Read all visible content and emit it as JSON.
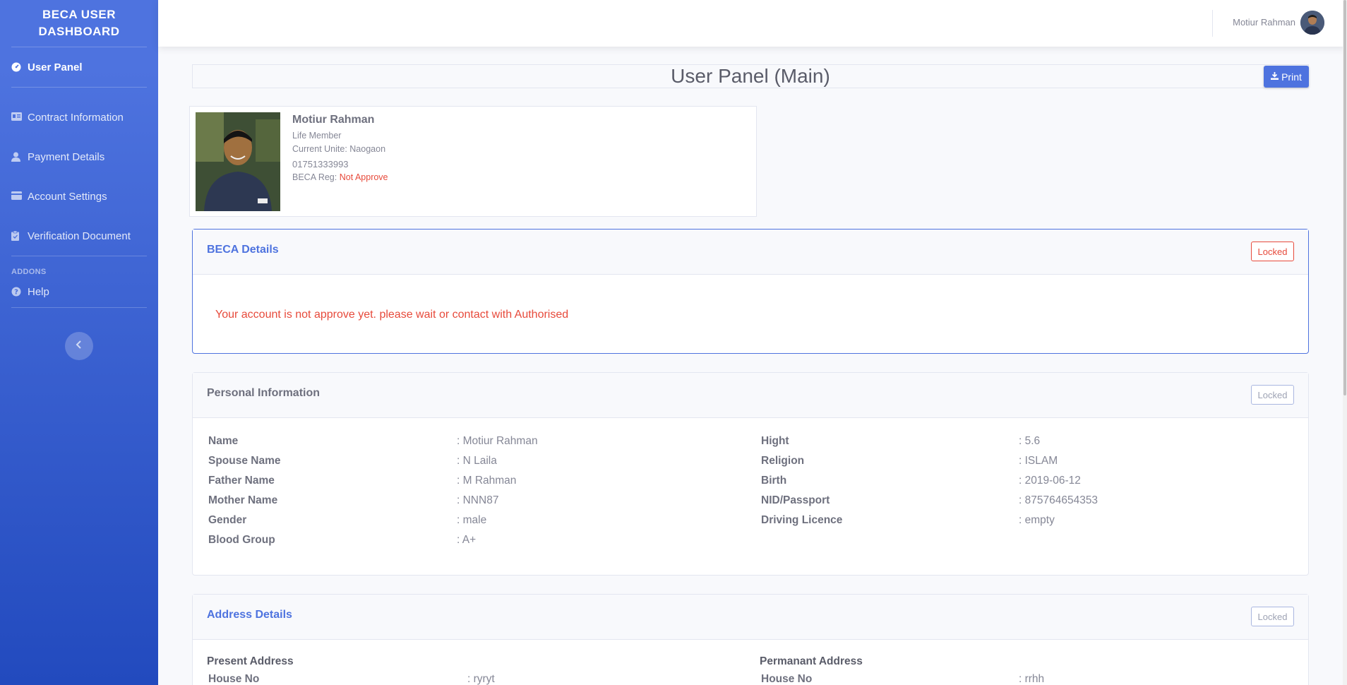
{
  "sidebar": {
    "brand": "BECA USER DASHBOARD",
    "items": [
      {
        "label": "User Panel",
        "icon": "tachometer-icon"
      },
      {
        "label": "Contract Information",
        "icon": "id-card-icon"
      },
      {
        "label": "Payment Details",
        "icon": "user-icon"
      },
      {
        "label": "Account Settings",
        "icon": "credit-card-icon"
      },
      {
        "label": "Verification Document",
        "icon": "clipboard-icon"
      }
    ],
    "addons_heading": "ADDONS",
    "help": "Help"
  },
  "topbar": {
    "user_name": "Motiur Rahman"
  },
  "page": {
    "title": "User Panel (Main)",
    "print_label": "Print"
  },
  "profile": {
    "name": "Motiur Rahman",
    "member_type": "Life Member",
    "current_unit": "Current Unite: Naogaon",
    "phone": "01751333993",
    "reg_label": "BECA Reg:",
    "reg_status": "Not Approve"
  },
  "beca_details": {
    "title": "BECA Details",
    "lock_label": "Locked",
    "message": "Your account is not approve yet. please wait or contact with Authorised"
  },
  "personal": {
    "title": "Personal Information",
    "lock_label": "Locked",
    "left": [
      {
        "label": "Name",
        "value": ": Motiur Rahman"
      },
      {
        "label": "Spouse Name",
        "value": ": N Laila"
      },
      {
        "label": "Father Name",
        "value": ": M Rahman"
      },
      {
        "label": "Mother Name",
        "value": ": NNN87"
      },
      {
        "label": "Gender",
        "value": ": male"
      },
      {
        "label": "Blood Group",
        "value": ": A+"
      }
    ],
    "right": [
      {
        "label": "Hight",
        "value": ": 5.6"
      },
      {
        "label": "Religion",
        "value": ": ISLAM"
      },
      {
        "label": "Birth",
        "value": ": 2019-06-12"
      },
      {
        "label": "NID/Passport",
        "value": ": 875764654353"
      },
      {
        "label": "Driving Licence",
        "value": ": empty"
      }
    ]
  },
  "address": {
    "title": "Address Details",
    "lock_label": "Locked",
    "present_heading": "Present Address",
    "permanent_heading": "Permanant Address",
    "present_house_label": "House No",
    "present_house_value": ": ryryt",
    "permanent_house_label": "House No",
    "permanent_house_value": ": rrhh"
  },
  "colors": {
    "primary": "#4e73df",
    "danger": "#e74a3b"
  }
}
